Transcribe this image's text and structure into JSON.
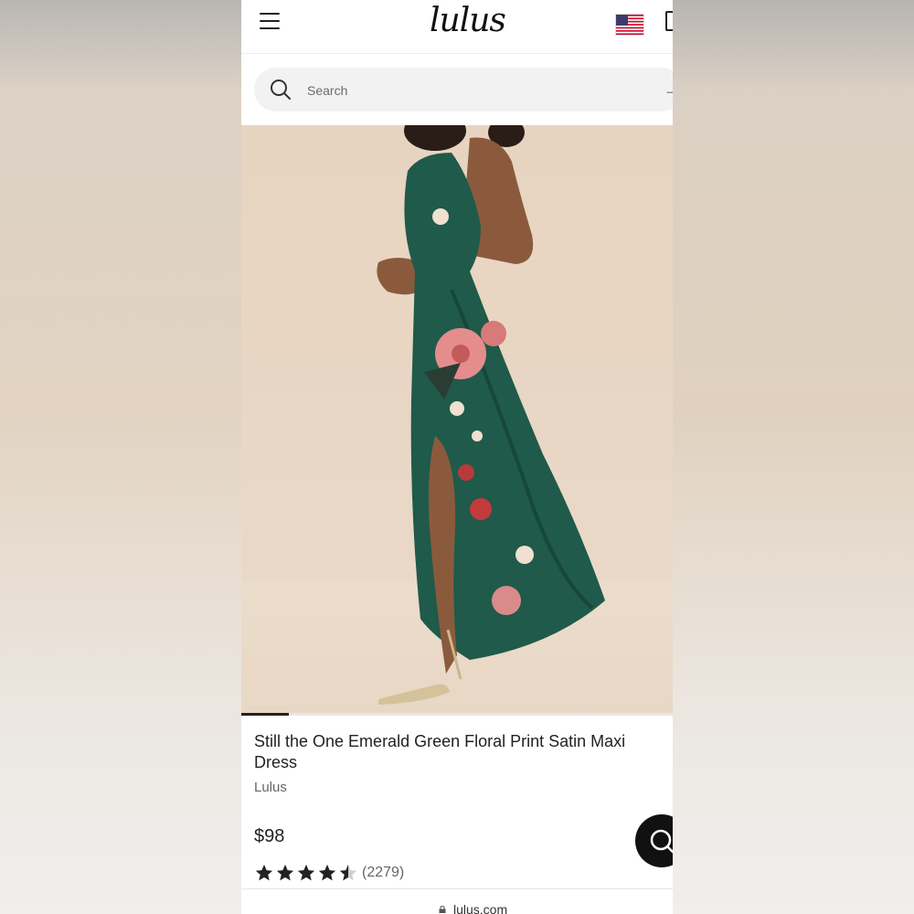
{
  "header": {
    "logo_text": "lulus",
    "flag": "us-flag-icon",
    "menu_icon": "hamburger-menu-icon",
    "bag_icon": "shopping-bag-icon"
  },
  "search": {
    "placeholder": "Search",
    "icon": "search-icon",
    "submit_icon": "arrow-right-icon"
  },
  "carousel": {
    "current_slide_fraction": 0.11
  },
  "product": {
    "title": "Still the One Emerald Green Floral Print Satin Maxi Dress",
    "brand": "Lulus",
    "price": "$98",
    "rating": 4.5,
    "rating_max": 5,
    "review_count": "(2279)",
    "image_description_icon": "product-photo"
  },
  "chat": {
    "icon": "chat-search-icon"
  },
  "browser": {
    "url": "lulus.com",
    "lock_icon": "lock-icon"
  },
  "colors": {
    "dress": "#1f5a4a",
    "background": "#e7d4c0",
    "text_primary": "#222222",
    "star": "#222222"
  }
}
